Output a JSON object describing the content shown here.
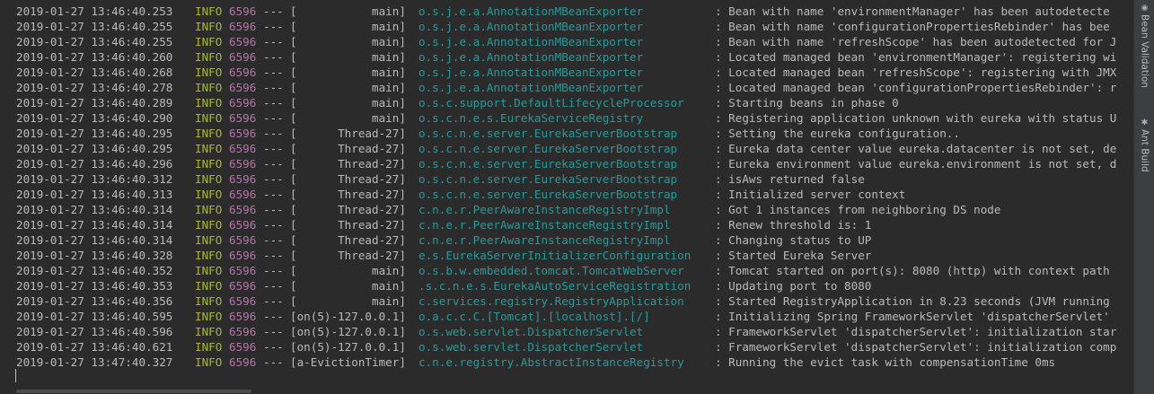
{
  "console": {
    "lines": [
      {
        "ts": "2019-01-27 13:46:40.253",
        "level": "INFO",
        "pid": "6596",
        "sep": "---",
        "thread": "[           main]",
        "logger": "o.s.j.e.a.AnnotationMBeanExporter",
        "msg": ": Bean with name 'environmentManager' has been autodetecte"
      },
      {
        "ts": "2019-01-27 13:46:40.255",
        "level": "INFO",
        "pid": "6596",
        "sep": "---",
        "thread": "[           main]",
        "logger": "o.s.j.e.a.AnnotationMBeanExporter",
        "msg": ": Bean with name 'configurationPropertiesRebinder' has bee"
      },
      {
        "ts": "2019-01-27 13:46:40.255",
        "level": "INFO",
        "pid": "6596",
        "sep": "---",
        "thread": "[           main]",
        "logger": "o.s.j.e.a.AnnotationMBeanExporter",
        "msg": ": Bean with name 'refreshScope' has been autodetected for J"
      },
      {
        "ts": "2019-01-27 13:46:40.260",
        "level": "INFO",
        "pid": "6596",
        "sep": "---",
        "thread": "[           main]",
        "logger": "o.s.j.e.a.AnnotationMBeanExporter",
        "msg": ": Located managed bean 'environmentManager': registering wi"
      },
      {
        "ts": "2019-01-27 13:46:40.268",
        "level": "INFO",
        "pid": "6596",
        "sep": "---",
        "thread": "[           main]",
        "logger": "o.s.j.e.a.AnnotationMBeanExporter",
        "msg": ": Located managed bean 'refreshScope': registering with JMX"
      },
      {
        "ts": "2019-01-27 13:46:40.278",
        "level": "INFO",
        "pid": "6596",
        "sep": "---",
        "thread": "[           main]",
        "logger": "o.s.j.e.a.AnnotationMBeanExporter",
        "msg": ": Located managed bean 'configurationPropertiesRebinder': r"
      },
      {
        "ts": "2019-01-27 13:46:40.289",
        "level": "INFO",
        "pid": "6596",
        "sep": "---",
        "thread": "[           main]",
        "logger": "o.s.c.support.DefaultLifecycleProcessor",
        "msg": ": Starting beans in phase 0"
      },
      {
        "ts": "2019-01-27 13:46:40.290",
        "level": "INFO",
        "pid": "6596",
        "sep": "---",
        "thread": "[           main]",
        "logger": "o.s.c.n.e.s.EurekaServiceRegistry",
        "msg": ": Registering application unknown with eureka with status U"
      },
      {
        "ts": "2019-01-27 13:46:40.295",
        "level": "INFO",
        "pid": "6596",
        "sep": "---",
        "thread": "[      Thread-27]",
        "logger": "o.s.c.n.e.server.EurekaServerBootstrap",
        "msg": ": Setting the eureka configuration.."
      },
      {
        "ts": "2019-01-27 13:46:40.295",
        "level": "INFO",
        "pid": "6596",
        "sep": "---",
        "thread": "[      Thread-27]",
        "logger": "o.s.c.n.e.server.EurekaServerBootstrap",
        "msg": ": Eureka data center value eureka.datacenter is not set, de"
      },
      {
        "ts": "2019-01-27 13:46:40.296",
        "level": "INFO",
        "pid": "6596",
        "sep": "---",
        "thread": "[      Thread-27]",
        "logger": "o.s.c.n.e.server.EurekaServerBootstrap",
        "msg": ": Eureka environment value eureka.environment is not set, d"
      },
      {
        "ts": "2019-01-27 13:46:40.312",
        "level": "INFO",
        "pid": "6596",
        "sep": "---",
        "thread": "[      Thread-27]",
        "logger": "o.s.c.n.e.server.EurekaServerBootstrap",
        "msg": ": isAws returned false"
      },
      {
        "ts": "2019-01-27 13:46:40.313",
        "level": "INFO",
        "pid": "6596",
        "sep": "---",
        "thread": "[      Thread-27]",
        "logger": "o.s.c.n.e.server.EurekaServerBootstrap",
        "msg": ": Initialized server context"
      },
      {
        "ts": "2019-01-27 13:46:40.314",
        "level": "INFO",
        "pid": "6596",
        "sep": "---",
        "thread": "[      Thread-27]",
        "logger": "c.n.e.r.PeerAwareInstanceRegistryImpl",
        "msg": ": Got 1 instances from neighboring DS node"
      },
      {
        "ts": "2019-01-27 13:46:40.314",
        "level": "INFO",
        "pid": "6596",
        "sep": "---",
        "thread": "[      Thread-27]",
        "logger": "c.n.e.r.PeerAwareInstanceRegistryImpl",
        "msg": ": Renew threshold is: 1"
      },
      {
        "ts": "2019-01-27 13:46:40.314",
        "level": "INFO",
        "pid": "6596",
        "sep": "---",
        "thread": "[      Thread-27]",
        "logger": "c.n.e.r.PeerAwareInstanceRegistryImpl",
        "msg": ": Changing status to UP"
      },
      {
        "ts": "2019-01-27 13:46:40.328",
        "level": "INFO",
        "pid": "6596",
        "sep": "---",
        "thread": "[      Thread-27]",
        "logger": "e.s.EurekaServerInitializerConfiguration",
        "msg": ": Started Eureka Server"
      },
      {
        "ts": "2019-01-27 13:46:40.352",
        "level": "INFO",
        "pid": "6596",
        "sep": "---",
        "thread": "[           main]",
        "logger": "o.s.b.w.embedded.tomcat.TomcatWebServer",
        "msg": ": Tomcat started on port(s): 8080 (http) with context path"
      },
      {
        "ts": "2019-01-27 13:46:40.353",
        "level": "INFO",
        "pid": "6596",
        "sep": "---",
        "thread": "[           main]",
        "logger": ".s.c.n.e.s.EurekaAutoServiceRegistration",
        "msg": ": Updating port to 8080"
      },
      {
        "ts": "2019-01-27 13:46:40.356",
        "level": "INFO",
        "pid": "6596",
        "sep": "---",
        "thread": "[           main]",
        "logger": "c.services.registry.RegistryApplication",
        "msg": ": Started RegistryApplication in 8.23 seconds (JVM running"
      },
      {
        "ts": "2019-01-27 13:46:40.595",
        "level": "INFO",
        "pid": "6596",
        "sep": "---",
        "thread": "[on(5)-127.0.0.1]",
        "logger": "o.a.c.c.C.[Tomcat].[localhost].[/]",
        "msg": ": Initializing Spring FrameworkServlet 'dispatcherServlet'"
      },
      {
        "ts": "2019-01-27 13:46:40.596",
        "level": "INFO",
        "pid": "6596",
        "sep": "---",
        "thread": "[on(5)-127.0.0.1]",
        "logger": "o.s.web.servlet.DispatcherServlet",
        "msg": ": FrameworkServlet 'dispatcherServlet': initialization star"
      },
      {
        "ts": "2019-01-27 13:46:40.621",
        "level": "INFO",
        "pid": "6596",
        "sep": "---",
        "thread": "[on(5)-127.0.0.1]",
        "logger": "o.s.web.servlet.DispatcherServlet",
        "msg": ": FrameworkServlet 'dispatcherServlet': initialization comp"
      },
      {
        "ts": "2019-01-27 13:47:40.327",
        "level": "INFO",
        "pid": "6596",
        "sep": "---",
        "thread": "[a-EvictionTimer]",
        "logger": "c.n.e.registry.AbstractInstanceRegistry",
        "msg": ": Running the evict task with compensationTime 0ms"
      }
    ]
  },
  "right_toolbar": {
    "tabs": [
      {
        "label": "Bean Validation",
        "icon": "bean-validation-icon"
      },
      {
        "label": "Ant Build",
        "icon": "ant-build-icon"
      }
    ]
  },
  "colors": {
    "background": "#2b2b2b",
    "text": "#bababa",
    "level": "#aab53a",
    "pid": "#b375a8",
    "logger": "#299999",
    "toolbar": "#3c3f41"
  }
}
